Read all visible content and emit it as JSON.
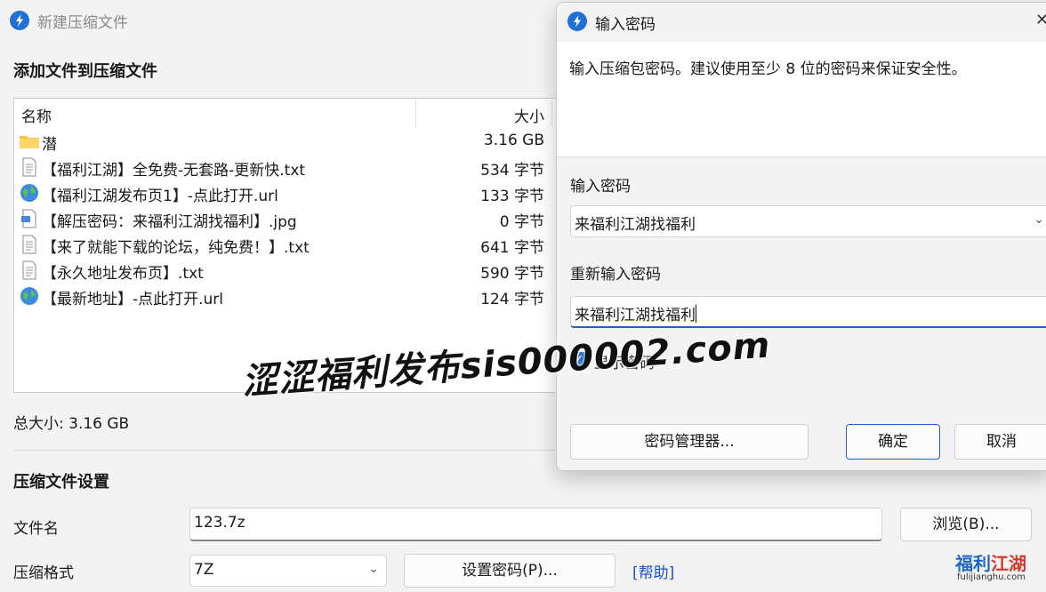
{
  "main_window": {
    "title": "新建压缩文件",
    "add_heading": "添加文件到压缩文件",
    "list_header": {
      "name": "名称",
      "size": "大小"
    },
    "files": [
      {
        "icon": "folder-icon",
        "name": "潜",
        "size": "3.16 GB"
      },
      {
        "icon": "text-file-icon",
        "name": "【福利江湖】全免费-无套路-更新快.txt",
        "size": "534 字节"
      },
      {
        "icon": "globe-icon",
        "name": "【福利江湖发布页1】-点此打开.url",
        "size": "133 字节"
      },
      {
        "icon": "image-file-icon",
        "name": "【解压密码：来福利江湖找福利】.jpg",
        "size": "0 字节"
      },
      {
        "icon": "text-file-icon",
        "name": "【来了就能下载的论坛，纯免费！】.txt",
        "size": "641 字节"
      },
      {
        "icon": "text-file-icon",
        "name": "【永久地址发布页】.txt",
        "size": "590 字节"
      },
      {
        "icon": "globe-icon",
        "name": "【最新地址】-点此打开.url",
        "size": "124 字节"
      }
    ],
    "total_size": "总大小: 3.16 GB",
    "settings_heading": "压缩文件设置",
    "filename_label": "文件名",
    "filename_value": "123.7z",
    "browse_label": "浏览(B)...",
    "format_label": "压缩格式",
    "format_value": "7Z",
    "set_password_label": "设置密码(P)...",
    "help_label": "[帮助]"
  },
  "password_dialog": {
    "title": "输入密码",
    "description": "输入压缩包密码。建议使用至少 8 位的密码来保证安全性。",
    "password_label": "输入密码",
    "password_value": "来福利江湖找福利",
    "reenter_label": "重新输入密码",
    "reenter_value": "来福利江湖找福利",
    "show_password_label": "显示密码",
    "show_password_checked": true,
    "manager_button": "密码管理器...",
    "ok_button": "确定",
    "cancel_button": "取消",
    "close_glyph": "✕"
  },
  "watermark": {
    "text": "涩涩福利发布sis000002.com",
    "logo_main_blue": "福利",
    "logo_main_red": "江湖",
    "logo_sub": "fulijianghu.com"
  },
  "colors": {
    "accent": "#1f66c8",
    "link": "#1a4fd0",
    "window_bg": "#f3f3f3"
  }
}
